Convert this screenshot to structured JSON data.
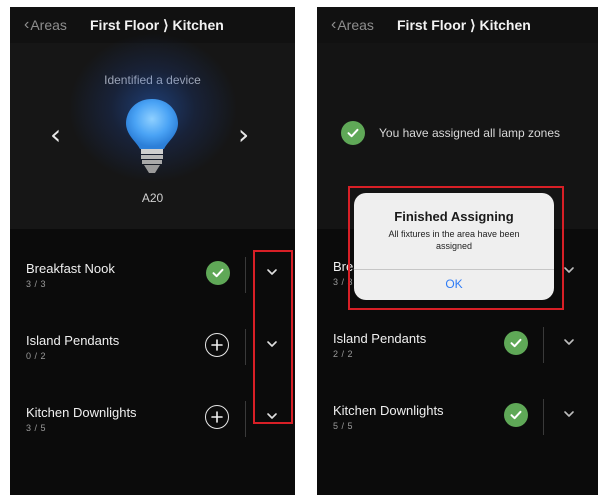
{
  "left": {
    "nav": {
      "back_label": "Areas",
      "title": "First Floor ⟩ Kitchen"
    },
    "hero": {
      "caption": "Identified a device",
      "device_name": "A20"
    },
    "rows": [
      {
        "name": "Breakfast Nook",
        "count": "3 / 3",
        "status": "assigned"
      },
      {
        "name": "Island Pendants",
        "count": "0 / 2",
        "status": "add"
      },
      {
        "name": "Kitchen Downlights",
        "count": "3 / 5",
        "status": "add"
      }
    ]
  },
  "right": {
    "nav": {
      "back_label": "Areas",
      "title": "First Floor ⟩ Kitchen"
    },
    "banner": {
      "text": "You have assigned all lamp zones"
    },
    "rows": [
      {
        "name": "Breakfast Nook",
        "count": "3 / 3",
        "status": "assigned"
      },
      {
        "name": "Island Pendants",
        "count": "2 / 2",
        "status": "assigned"
      },
      {
        "name": "Kitchen Downlights",
        "count": "5 / 5",
        "status": "assigned"
      }
    ],
    "alert": {
      "title": "Finished Assigning",
      "message": "All fixtures in the area have been assigned",
      "ok_label": "OK"
    }
  },
  "colors": {
    "accent_green": "#5fa857",
    "highlight_red": "#d81f26",
    "link_blue": "#2f7cf6"
  },
  "icons": [
    "chevron-left-icon",
    "chevron-right-icon",
    "bulb-icon",
    "check-icon",
    "plus-icon",
    "chevron-down-icon"
  ]
}
